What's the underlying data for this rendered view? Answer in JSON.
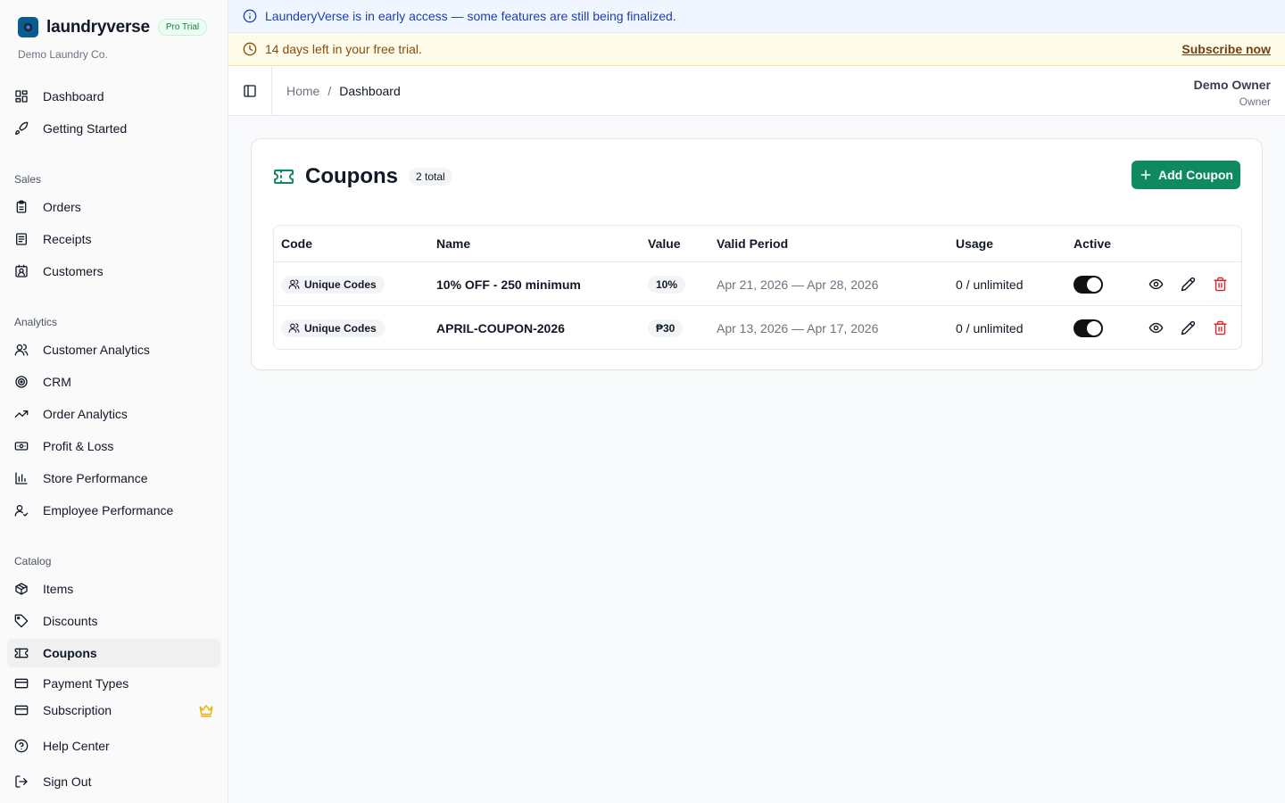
{
  "brand": {
    "name": "laundryverse",
    "badge": "Pro Trial",
    "org": "Demo Laundry Co."
  },
  "sidebar": {
    "items": [
      {
        "label": "Dashboard",
        "icon": "layout-grid-icon"
      },
      {
        "label": "Getting Started",
        "icon": "rocket-icon"
      }
    ],
    "sections": [
      {
        "title": "Sales",
        "items": [
          {
            "label": "Orders",
            "icon": "clipboard-icon"
          },
          {
            "label": "Receipts",
            "icon": "receipt-icon"
          },
          {
            "label": "Customers",
            "icon": "contact-icon"
          }
        ]
      },
      {
        "title": "Analytics",
        "items": [
          {
            "label": "Customer Analytics",
            "icon": "users-icon"
          },
          {
            "label": "CRM",
            "icon": "target-icon"
          },
          {
            "label": "Order Analytics",
            "icon": "trending-up-icon"
          },
          {
            "label": "Profit & Loss",
            "icon": "banknote-icon"
          },
          {
            "label": "Store Performance",
            "icon": "bar-chart-icon"
          },
          {
            "label": "Employee Performance",
            "icon": "user-check-icon"
          }
        ]
      },
      {
        "title": "Catalog",
        "items": [
          {
            "label": "Items",
            "icon": "package-icon"
          },
          {
            "label": "Discounts",
            "icon": "tag-icon"
          },
          {
            "label": "Coupons",
            "icon": "ticket-icon",
            "active": true
          },
          {
            "label": "Payment Types",
            "icon": "credit-card-icon"
          }
        ]
      }
    ],
    "footer": [
      {
        "label": "Subscription",
        "icon": "wallet-icon",
        "extra_icon": "crown-icon"
      },
      {
        "label": "Help Center",
        "icon": "help-circle-icon"
      },
      {
        "label": "Sign Out",
        "icon": "log-out-icon"
      }
    ]
  },
  "banners": {
    "info": "LaunderyVerse is in early access — some features are still being finalized.",
    "trial": "14 days left in your free trial.",
    "subscribe": "Subscribe now"
  },
  "header": {
    "breadcrumb": [
      "Home",
      "Dashboard"
    ],
    "user_name": "Demo Owner",
    "user_role": "Owner"
  },
  "coupons": {
    "title": "Coupons",
    "total": "2 total",
    "add_label": "Add Coupon",
    "columns": [
      "Code",
      "Name",
      "Value",
      "Valid Period",
      "Usage",
      "Active"
    ],
    "rows": [
      {
        "code": "Unique Codes",
        "name": "10% OFF - 250 minimum",
        "value": "10%",
        "period": "Apr 21, 2026 — Apr 28, 2026",
        "usage": "0 / unlimited",
        "active": true
      },
      {
        "code": "Unique Codes",
        "name": "APRIL-COUPON-2026",
        "value": "₱30",
        "period": "Apr 13, 2026 — Apr 17, 2026",
        "usage": "0 / unlimited",
        "active": true
      }
    ]
  },
  "colors": {
    "primary": "#0f8a5f",
    "danger": "#dc2626",
    "info_bg": "#eff6ff",
    "trial_bg": "#fefce8",
    "crown": "#eab308"
  }
}
